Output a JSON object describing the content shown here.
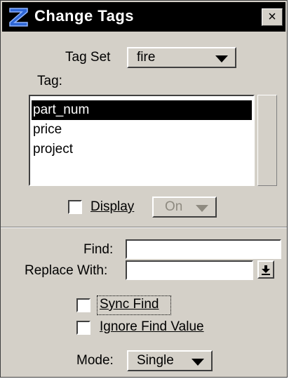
{
  "window": {
    "title": "Change Tags",
    "close_glyph": "×",
    "app_icon": "microstation-logo-icon"
  },
  "tag_set": {
    "label": "Tag Set",
    "value": "fire"
  },
  "tag": {
    "label": "Tag:",
    "items": [
      "part_num",
      "price",
      "project"
    ],
    "selected": "part_num"
  },
  "display": {
    "label": "Display",
    "checked": false,
    "value": "On",
    "enabled": false
  },
  "find": {
    "label": "Find:",
    "value": ""
  },
  "replace": {
    "label": "Replace With:",
    "value": ""
  },
  "options": {
    "sync_find": {
      "label": "Sync Find",
      "checked": false
    },
    "ignore_find_value": {
      "label": "Ignore Find Value",
      "checked": false
    }
  },
  "mode": {
    "label": "Mode:",
    "value": "Single"
  }
}
